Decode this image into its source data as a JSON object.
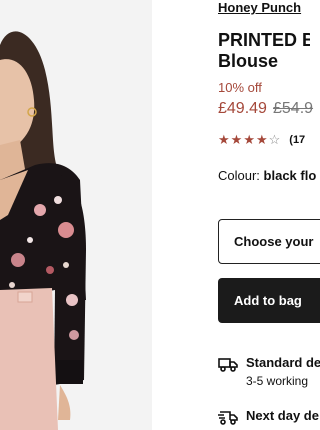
{
  "product": {
    "brand": "Honey Punch",
    "title_line1": "PRINTED B",
    "title_line2": "Blouse",
    "discount": "10% off",
    "price_now": "£49.49",
    "price_was": "£54.9",
    "rating": 3.5,
    "rating_max": 5,
    "review_count": "(17",
    "colour_label": "Colour:",
    "colour_value": "black flo"
  },
  "actions": {
    "size_placeholder": "Choose your",
    "add_to_bag": "Add to bag"
  },
  "delivery": {
    "standard_title": "Standard de",
    "standard_sub": "3-5 working",
    "nextday_title": "Next day de"
  },
  "colors": {
    "accent": "#a5483a",
    "button_bg": "#1b1b1b"
  },
  "icons": {
    "delivery_truck": "truck-icon",
    "next_day": "fast-truck-icon"
  }
}
